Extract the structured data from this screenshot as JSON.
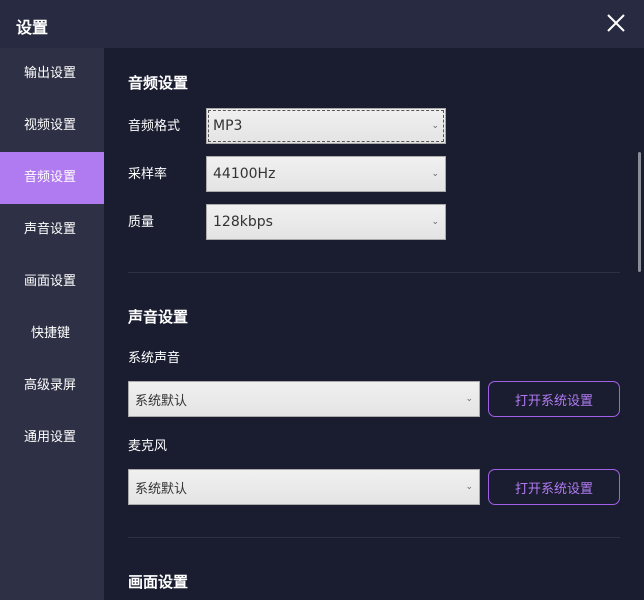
{
  "window": {
    "title": "设置"
  },
  "sidebar": {
    "items": [
      {
        "label": "输出设置"
      },
      {
        "label": "视频设置"
      },
      {
        "label": "音频设置"
      },
      {
        "label": "声音设置"
      },
      {
        "label": "画面设置"
      },
      {
        "label": "快捷键"
      },
      {
        "label": "高级录屏"
      },
      {
        "label": "通用设置"
      }
    ]
  },
  "audio": {
    "heading": "音频设置",
    "format": {
      "label": "音频格式",
      "value": "MP3"
    },
    "sample_rate": {
      "label": "采样率",
      "value": "44100Hz"
    },
    "quality": {
      "label": "质量",
      "value": "128kbps"
    }
  },
  "sound": {
    "heading": "声音设置",
    "system": {
      "label": "系统声音",
      "value": "系统默认",
      "button": "打开系统设置"
    },
    "mic": {
      "label": "麦克风",
      "value": "系统默认",
      "button": "打开系统设置"
    }
  },
  "screen": {
    "heading": "画面设置"
  },
  "colors": {
    "accent": "#b07af0",
    "background": "#1a1d30",
    "sidebar": "#2e3045"
  }
}
